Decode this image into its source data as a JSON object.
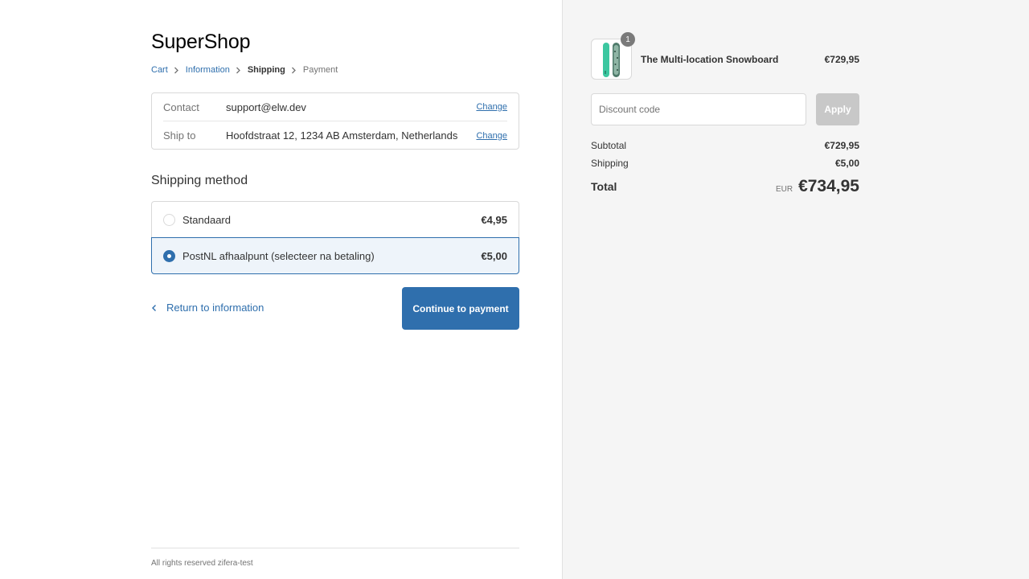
{
  "shop": {
    "name": "SuperShop"
  },
  "breadcrumb": [
    {
      "label": "Cart",
      "state": "link"
    },
    {
      "label": "Information",
      "state": "link"
    },
    {
      "label": "Shipping",
      "state": "current"
    },
    {
      "label": "Payment",
      "state": "future"
    }
  ],
  "review": {
    "contact": {
      "label": "Contact",
      "value": "support@elw.dev",
      "action": "Change"
    },
    "ship_to": {
      "label": "Ship to",
      "value": "Hoofdstraat 12, 1234 AB Amsterdam, Netherlands",
      "action": "Change"
    }
  },
  "shipping": {
    "title": "Shipping method",
    "methods": [
      {
        "label": "Standaard",
        "price": "€4,95",
        "selected": false
      },
      {
        "label": "PostNL afhaalpunt (selecteer na betaling)",
        "price": "€5,00",
        "selected": true
      }
    ]
  },
  "actions": {
    "return_label": "Return to information",
    "continue_label": "Continue to payment"
  },
  "footer": {
    "text": "All rights reserved zifera-test"
  },
  "summary": {
    "product": {
      "name": "The Multi-location Snowboard",
      "price": "€729,95",
      "quantity": "1"
    },
    "discount": {
      "placeholder": "Discount code",
      "button": "Apply"
    },
    "subtotal": {
      "label": "Subtotal",
      "value": "€729,95"
    },
    "shipping": {
      "label": "Shipping",
      "value": "€5,00"
    },
    "total": {
      "label": "Total",
      "currency": "EUR",
      "value": "€734,95"
    }
  },
  "colors": {
    "accent": "#2f6fad",
    "sidebar_bg": "#f5f5f5",
    "selected_bg": "#eef4fa"
  }
}
